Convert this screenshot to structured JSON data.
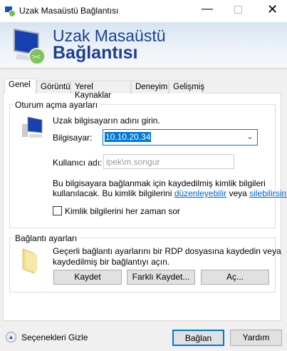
{
  "window": {
    "title": "Uzak Masaüstü Bağlantısı"
  },
  "banner": {
    "line1": "Uzak Masaüstü",
    "line2": "Bağlantısı"
  },
  "tabs": [
    {
      "label": "Genel",
      "active": true
    },
    {
      "label": "Görüntü"
    },
    {
      "label": "Yerel Kaynaklar"
    },
    {
      "label": "Deneyim"
    },
    {
      "label": "Gelişmiş"
    }
  ],
  "logon": {
    "title": "Oturum açma ayarları",
    "instruction": "Uzak bilgisayarın adını girin.",
    "computer_label": "Bilgisayar:",
    "computer_value": "10.10.20.34",
    "username_label": "Kullanıcı adı:",
    "username_value": "ipek\\m.songur",
    "info_line1": "Bu bilgisayara bağlanmak için kaydedilmiş kimlik bilgileri",
    "info_line2": "kullanılacak.  Bu kimlik bilgilerini",
    "edit_link": "düzenleyebilir",
    "or": "veya",
    "delete_link": "silebilirsiniz",
    "always_ask_label": "Kimlik bilgilerini her zaman sor",
    "always_ask_checked": false
  },
  "connection": {
    "title": "Bağlantı ayarları",
    "text_line1": "Geçerli bağlantı ayarlarını bir RDP dosyasına kaydedin veya",
    "text_line2": "kaydedilmiş bir bağlantıyı açın.",
    "save": "Kaydet",
    "save_as": "Farklı Kaydet...",
    "open": "Aç..."
  },
  "footer": {
    "hide_options": "Seçenekleri Gizle",
    "connect": "Bağlan",
    "help": "Yardım"
  }
}
